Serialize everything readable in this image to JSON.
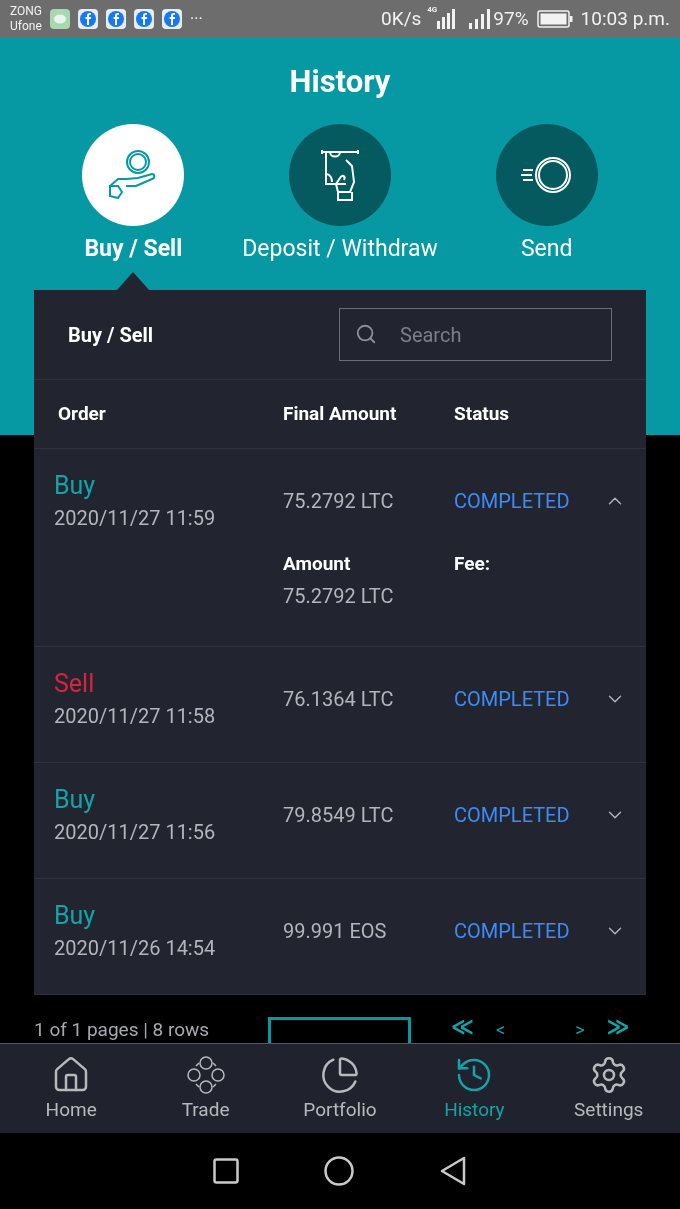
{
  "status_bar": {
    "carriers": [
      "ZONG",
      "Ufone"
    ],
    "more": "···",
    "speed": "0K/s",
    "network": "4G",
    "battery": "97%",
    "time": "10:03 p.m."
  },
  "title": "History",
  "tabs": [
    {
      "label": "Buy / Sell",
      "selected": true,
      "kind": "coin-hand"
    },
    {
      "label": "Deposit / Withdraw",
      "selected": false,
      "kind": "atm"
    },
    {
      "label": "Send",
      "selected": false,
      "kind": "send"
    }
  ],
  "panel": {
    "title": "Buy / Sell",
    "search": {
      "placeholder": "Search"
    },
    "columns": [
      "Order",
      "Final Amount",
      "Status"
    ],
    "rows": [
      {
        "kind": "buy",
        "type": "Buy",
        "date": "2020/11/27 11:59",
        "amount": "75.2792 LTC",
        "status": "COMPLETED",
        "expanded": true,
        "details": [
          {
            "label": "Amount",
            "value": "75.2792 LTC"
          },
          {
            "label": "Fee:"
          }
        ]
      },
      {
        "kind": "sell",
        "type": "Sell",
        "date": "2020/11/27 11:58",
        "amount": "76.1364 LTC",
        "status": "COMPLETED",
        "expanded": false
      },
      {
        "kind": "buy",
        "type": "Buy",
        "date": "2020/11/27 11:56",
        "amount": "79.8549 LTC",
        "status": "COMPLETED",
        "expanded": false
      },
      {
        "kind": "buy",
        "type": "Buy",
        "date": "2020/11/26 14:54",
        "amount": "99.991 EOS",
        "status": "COMPLETED",
        "expanded": false
      }
    ]
  },
  "pagination": {
    "info": "1 of 1 pages | 8 rows",
    "first": "≪",
    "prev": "<",
    "next": ">",
    "last": "≫"
  },
  "nav": [
    {
      "label": "Home",
      "selected": false,
      "kind": "home"
    },
    {
      "label": "Trade",
      "selected": false,
      "kind": "trade"
    },
    {
      "label": "Portfolio",
      "selected": false,
      "kind": "portfolio"
    },
    {
      "label": "History",
      "selected": true,
      "kind": "history"
    },
    {
      "label": "Settings",
      "selected": false,
      "kind": "settings"
    }
  ]
}
